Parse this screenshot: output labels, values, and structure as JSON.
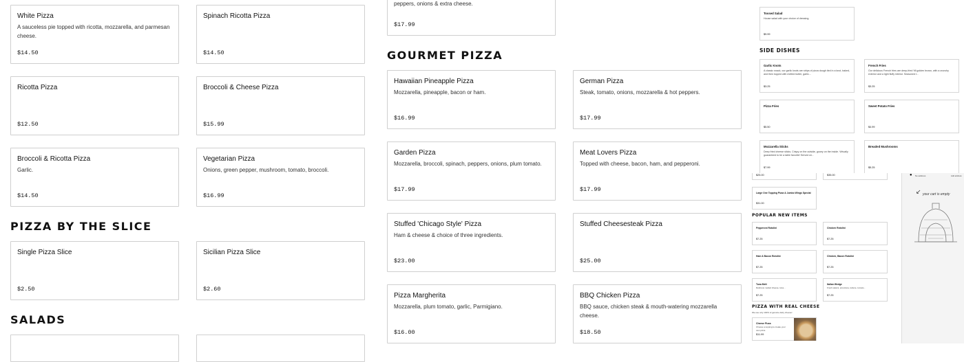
{
  "main": {
    "col1_top": [
      {
        "name": "White Pizza",
        "desc": "A sauceless pie topped with ricotta, mozzarella, and parmesan cheese.",
        "price": "$14.50"
      },
      {
        "name": "Ricotta Pizza",
        "desc": "",
        "price": "$12.50"
      },
      {
        "name": "Broccoli & Ricotta Pizza",
        "desc": "Garlic.",
        "price": "$14.50"
      }
    ],
    "col2_top": [
      {
        "name": "Spinach Ricotta Pizza",
        "desc": "",
        "price": "$14.50"
      },
      {
        "name": "Broccoli & Cheese Pizza",
        "desc": "",
        "price": "$15.99"
      },
      {
        "name": "Vegetarian Pizza",
        "desc": "Onions, green pepper, mushroom, tomato, broccoli.",
        "price": "$16.99"
      }
    ],
    "slice_title": "PIZZA BY THE SLICE",
    "slices": [
      {
        "name": "Single Pizza Slice",
        "desc": "",
        "price": "$2.50"
      },
      {
        "name": "Sicilian Pizza Slice",
        "desc": "",
        "price": "$2.60"
      }
    ],
    "salads_title": "SALADS",
    "partial_top": {
      "desc": "with pepperoni, mushrooms, sausage, meatball, green peppers, onions & extra cheese.",
      "price": "$17.99"
    },
    "gourmet_title": "GOURMET PIZZA",
    "gourmet": [
      {
        "name": "Hawaiian Pineapple Pizza",
        "desc": "Mozzarella, pineapple, bacon or ham.",
        "price": "$16.99"
      },
      {
        "name": "German Pizza",
        "desc": "Steak, tomato, onions, mozzarella & hot peppers.",
        "price": "$17.99"
      },
      {
        "name": "Garden Pizza",
        "desc": "Mozzarella, broccoli, spinach, peppers, onions, plum tomato.",
        "price": "$17.99"
      },
      {
        "name": "Meat Lovers Pizza",
        "desc": "Topped with cheese, bacon, ham, and pepperoni.",
        "price": "$17.99"
      },
      {
        "name": "Stuffed 'Chicago Style' Pizza",
        "desc": "Ham & cheese & choice of three ingredients.",
        "price": "$23.00"
      },
      {
        "name": "Stuffed Cheesesteak Pizza",
        "desc": "",
        "price": "$25.00"
      },
      {
        "name": "Pizza Margherita",
        "desc": "Mozzarella, plum tomato, garlic, Parmigiano.",
        "price": "$16.00"
      },
      {
        "name": "BBQ Chicken Pizza",
        "desc": "BBQ sauce, chicken steak & mouth-watering mozzarella cheese.",
        "price": "$18.50"
      }
    ]
  },
  "thumb_top": {
    "salad": {
      "name": "Tossed Salad",
      "desc": "House salad with your choice of dressing.",
      "price": "$9.99"
    },
    "side_title": "SIDE DISHES",
    "sides": [
      {
        "name": "Garlic Knots",
        "desc": "A classic snack, our garlic knots are strips of pizza dough tied in a knot, baked, and then topped with melted butter, garlic...",
        "price": "$3.25"
      },
      {
        "name": "French Fries",
        "desc": "Our delicious French fries are deep-fried 'till golden brown, with a crunchy exterior and a light fluffy interior. Seasoned t...",
        "price": "$3.25"
      },
      {
        "name": "Pizza Fries",
        "desc": "",
        "price": "$5.50"
      },
      {
        "name": "Sweet Potato Fries",
        "desc": "",
        "price": "$4.99"
      },
      {
        "name": "Mozzarella Sticks",
        "desc": "Deep fried cheese sticks. Crispy on the outside, gooey on the inside. Virtually guaranteed to be a table favorite! Served wi...",
        "price": "$7.99"
      },
      {
        "name": "Breaded Mushrooms",
        "desc": "",
        "price": "$5.25"
      }
    ]
  },
  "thumb_bottom": {
    "row0_prices": [
      "$25.00",
      "$35.00"
    ],
    "special": {
      "name": "Large One Topping Pizza & Jumbo Wings Special",
      "price": "$31.00"
    },
    "popular_title": "POPULAR NEW ITEMS",
    "popular": [
      {
        "name": "Pepperoni Rotolini",
        "desc": "",
        "price": "$7.25"
      },
      {
        "name": "Chicken Rotolini",
        "desc": "",
        "price": "$7.25"
      },
      {
        "name": "Ham & Bacon Rotolini",
        "desc": "",
        "price": "$7.25"
      },
      {
        "name": "Chicken, Bacon Rotolini",
        "desc": "",
        "price": "$7.25"
      },
      {
        "name": "Tuna Melt",
        "desc": "Delicious melted cheese, tuna...",
        "price": "$7.25"
      },
      {
        "name": "Italian Wedge",
        "desc": "Fresh salami, provolone, lettuce, tomato...",
        "price": "$7.25"
      }
    ],
    "real_cheese_title": "PIZZA WITH REAL CHEESE",
    "real_cheese_sub": "We use only 100% of genuine dairy cheese!",
    "cheese_item": {
      "name": "Cheese Pizza",
      "desc": "Choose a topping to create your own pizza",
      "price": "$11.99"
    },
    "cart": {
      "address": "No address",
      "link": "Add address",
      "empty_text": "your cart is empty"
    }
  }
}
